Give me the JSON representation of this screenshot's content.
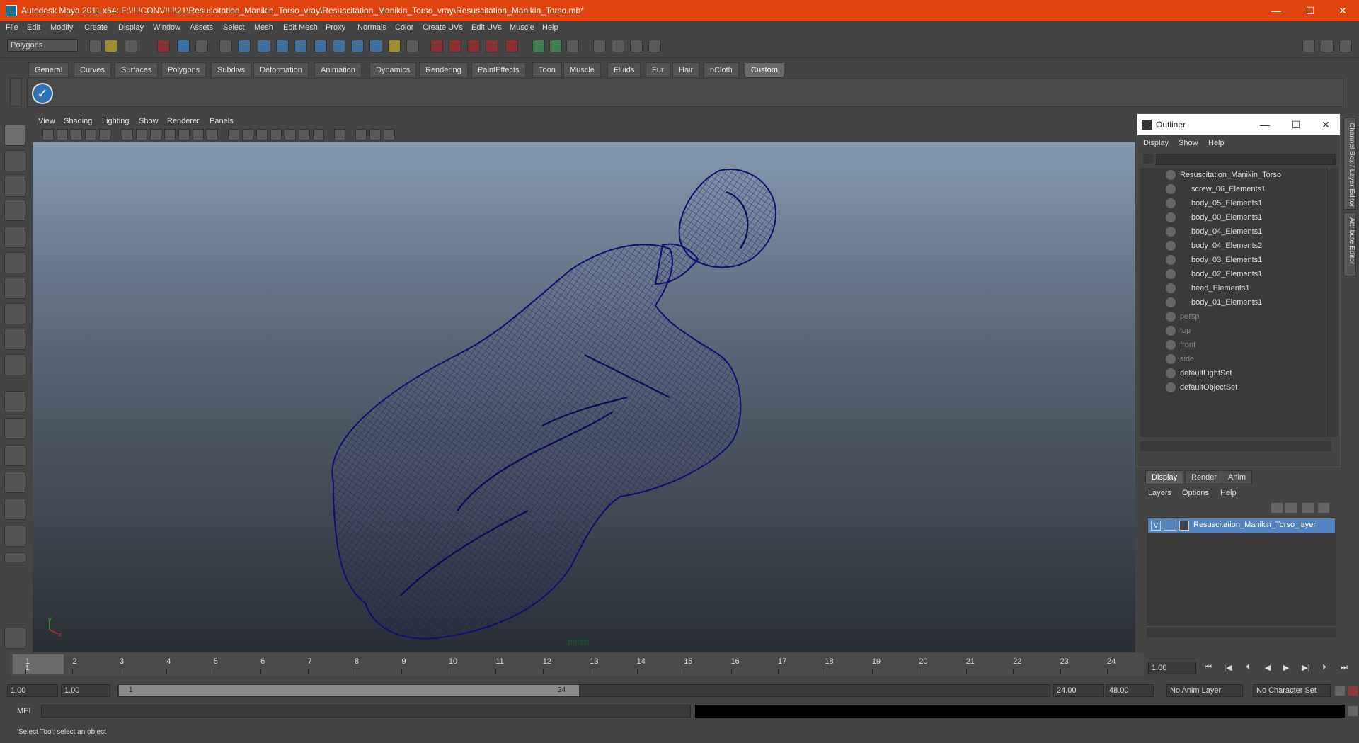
{
  "window": {
    "title": "Autodesk Maya 2011 x64: F:\\!!!!CONV!!!!\\21\\Resuscitation_Manikin_Torso_vray\\Resuscitation_Manikin_Torso_vray\\Resuscitation_Manikin_Torso.mb*",
    "controls": {
      "minimize": "—",
      "maximize": "☐",
      "close": "✕"
    },
    "accent_color": "#e0440e"
  },
  "menu": [
    "File",
    "Edit",
    "Modify",
    "Create",
    "Display",
    "Window",
    "Assets",
    "Select",
    "Mesh",
    "Edit Mesh",
    "Proxy",
    "Normals",
    "Color",
    "Create UVs",
    "Edit UVs",
    "Muscle",
    "Help"
  ],
  "mode_selector": {
    "value": "Polygons"
  },
  "shelf_tabs": [
    "General",
    "Curves",
    "Surfaces",
    "Polygons",
    "Subdivs",
    "Deformation",
    "Animation",
    "Dynamics",
    "Rendering",
    "PaintEffects",
    "Toon",
    "Muscle",
    "Fluids",
    "Fur",
    "Hair",
    "nCloth",
    "Custom"
  ],
  "active_shelf_tab": "Custom",
  "viewport": {
    "menu": [
      "View",
      "Shading",
      "Lighting",
      "Show",
      "Renderer",
      "Panels"
    ],
    "camera_label": "persp",
    "axis": {
      "y": "y",
      "x": "x"
    }
  },
  "outliner": {
    "title": "Outliner",
    "menu": [
      "Display",
      "Show",
      "Help"
    ],
    "items": [
      {
        "label": "Resuscitation_Manikin_Torso",
        "level": 0,
        "dim": false
      },
      {
        "label": "screw_06_Elements1",
        "level": 1,
        "dim": false
      },
      {
        "label": "body_05_Elements1",
        "level": 1,
        "dim": false
      },
      {
        "label": "body_00_Elements1",
        "level": 1,
        "dim": false
      },
      {
        "label": "body_04_Elements1",
        "level": 1,
        "dim": false
      },
      {
        "label": "body_04_Elements2",
        "level": 1,
        "dim": false
      },
      {
        "label": "body_03_Elements1",
        "level": 1,
        "dim": false
      },
      {
        "label": "body_02_Elements1",
        "level": 1,
        "dim": false
      },
      {
        "label": "head_Elements1",
        "level": 1,
        "dim": false
      },
      {
        "label": "body_01_Elements1",
        "level": 1,
        "dim": false
      },
      {
        "label": "persp",
        "level": 0,
        "dim": true
      },
      {
        "label": "top",
        "level": 0,
        "dim": true
      },
      {
        "label": "front",
        "level": 0,
        "dim": true
      },
      {
        "label": "side",
        "level": 0,
        "dim": true
      },
      {
        "label": "defaultLightSet",
        "level": 0,
        "dim": false
      },
      {
        "label": "defaultObjectSet",
        "level": 0,
        "dim": false
      }
    ]
  },
  "layer_editor": {
    "tabs": [
      "Display",
      "Render",
      "Anim"
    ],
    "active_tab": "Display",
    "menu": [
      "Layers",
      "Options",
      "Help"
    ],
    "layers": [
      {
        "visible": "V",
        "name": "Resuscitation_Manikin_Torso_layer"
      }
    ]
  },
  "side_tabs": [
    "Channel Box / Layer Editor",
    "Attribute Editor"
  ],
  "timeline": {
    "ticks": [
      "1",
      "2",
      "3",
      "4",
      "5",
      "6",
      "7",
      "8",
      "9",
      "10",
      "11",
      "12",
      "13",
      "14",
      "15",
      "16",
      "17",
      "18",
      "19",
      "20",
      "21",
      "22",
      "23",
      "24"
    ],
    "current_frame": "1",
    "current_time": "1.00"
  },
  "range": {
    "start": "1.00",
    "playback_start": "1.00",
    "slider_start": "1",
    "slider_end": "24",
    "playback_end": "24.00",
    "end": "48.00",
    "anim_layer": "No Anim Layer",
    "character_set": "No Character Set"
  },
  "command_line": {
    "label": "MEL"
  },
  "help_line": "Select Tool: select an object"
}
